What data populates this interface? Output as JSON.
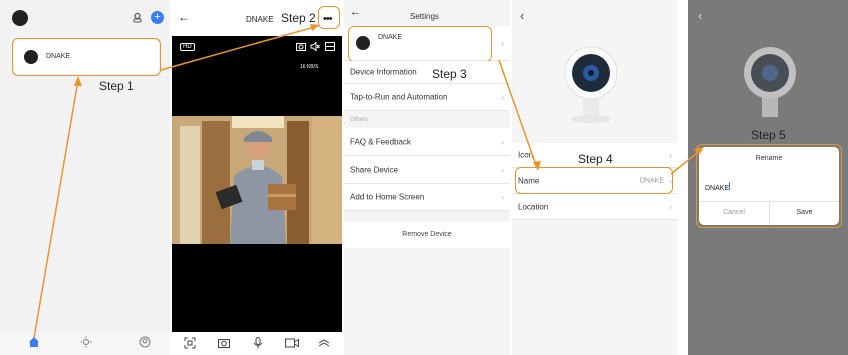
{
  "steps": {
    "step1": "Step 1",
    "step2": "Step 2",
    "step3": "Step 3",
    "step4": "Step 4",
    "step5": "Step 5"
  },
  "home": {
    "device_name": "DNAKE",
    "add_icon": "plus-circle-icon",
    "tabs": [
      "home-icon",
      "sun-icon",
      "user-icon"
    ]
  },
  "live": {
    "title": "DNAKE",
    "hd_badge": "HD",
    "speed": "16 KB/S",
    "more_icon": "more-dots-icon",
    "toolbar_icons": [
      "screenshot-icon",
      "camera-icon",
      "mic-icon",
      "record-icon",
      "expand-icon"
    ]
  },
  "settings": {
    "title": "Settings",
    "device_name": "DNAKE",
    "items": [
      {
        "label": "Device Information"
      },
      {
        "label": "Tap-to-Run and Automation"
      }
    ],
    "section_label": "Others",
    "others": [
      {
        "label": "FAQ & Feedback"
      },
      {
        "label": "Share Device"
      },
      {
        "label": "Add to Home Screen"
      }
    ],
    "remove_label": "Remove Device"
  },
  "device_info": {
    "icon_label": "Icon",
    "name_label": "Name",
    "name_value": "DNAKE",
    "location_label": "Location"
  },
  "rename": {
    "title": "Rename",
    "value": "DNAKE",
    "cancel": "Cancel",
    "save": "Save"
  },
  "colors": {
    "accent": "#e9952f",
    "blue": "#3d7cf5",
    "dim_overlay": "#7a7a7a"
  }
}
